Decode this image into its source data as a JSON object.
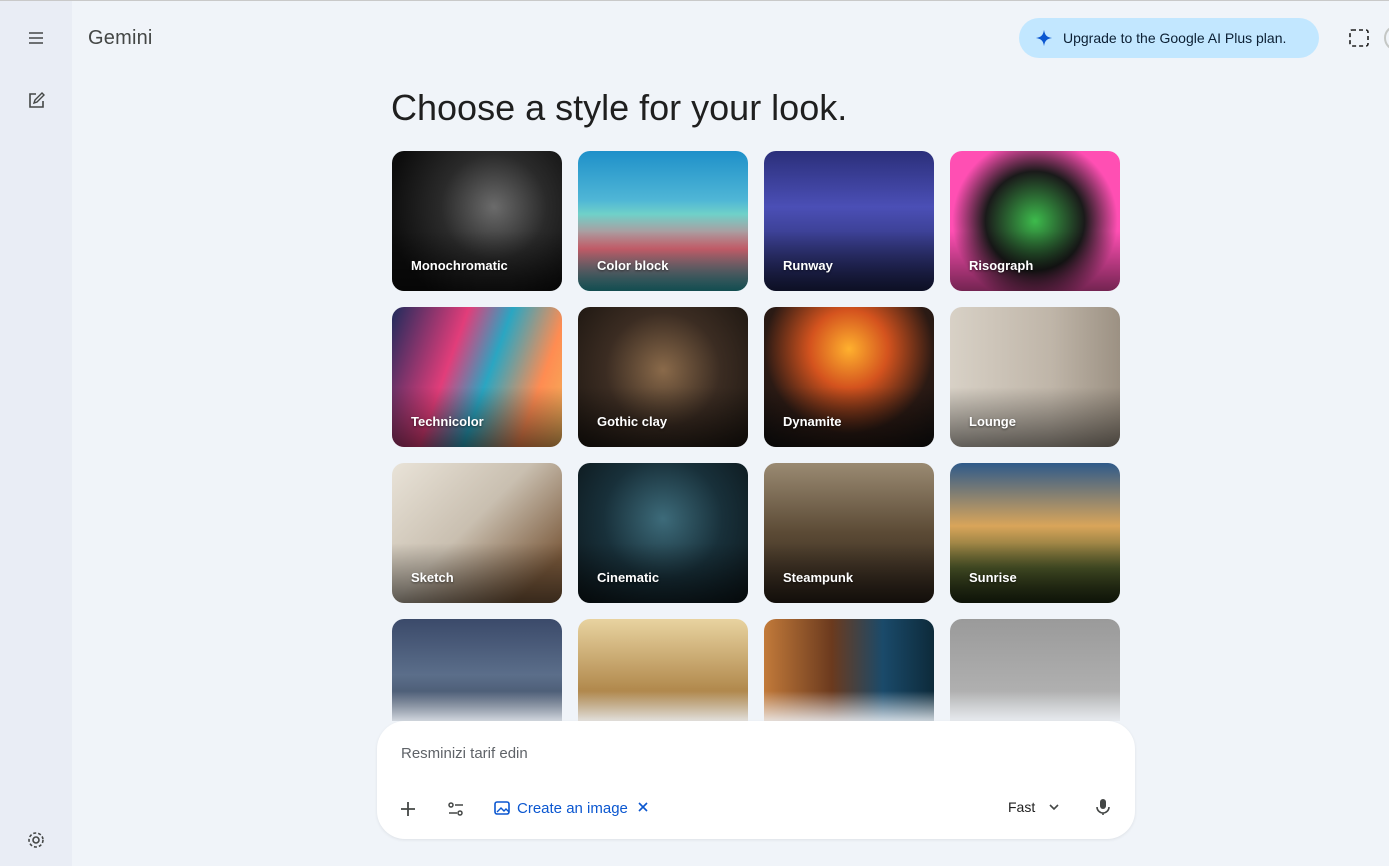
{
  "app": {
    "brand": "Gemini"
  },
  "header": {
    "upgrade_label": "Upgrade to the Google AI Plus plan."
  },
  "main": {
    "heading": "Choose a style for your look."
  },
  "styles": [
    {
      "label": "Monochromatic"
    },
    {
      "label": "Color block"
    },
    {
      "label": "Runway"
    },
    {
      "label": "Risograph"
    },
    {
      "label": "Technicolor"
    },
    {
      "label": "Gothic clay"
    },
    {
      "label": "Dynamite"
    },
    {
      "label": "Lounge"
    },
    {
      "label": "Sketch"
    },
    {
      "label": "Cinematic"
    },
    {
      "label": "Steampunk"
    },
    {
      "label": "Sunrise"
    },
    {
      "label": ""
    },
    {
      "label": ""
    },
    {
      "label": ""
    },
    {
      "label": ""
    }
  ],
  "prompt": {
    "placeholder": "Resminizi tarif edin",
    "tool_chip": "Create an image",
    "model": "Fast"
  },
  "colors": {
    "accent": "#0b57d0",
    "upgrade_bg": "#c2e7ff",
    "background": "#f0f4f9"
  },
  "icons": [
    "menu-icon",
    "edit-icon",
    "settings-icon",
    "sparkle-icon",
    "screen-capture-icon",
    "plus-icon",
    "tools-icon",
    "image-icon",
    "close-icon",
    "chevron-down-icon",
    "mic-icon"
  ]
}
